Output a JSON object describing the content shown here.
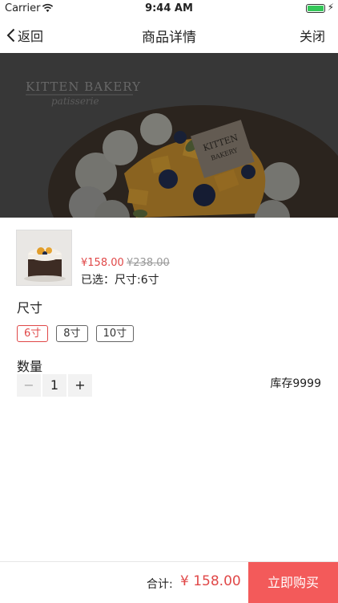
{
  "status": {
    "carrier": "Carrier",
    "time": "9:44 AM"
  },
  "nav": {
    "back_label": "返回",
    "title": "商品详情",
    "close_label": "关闭"
  },
  "hero": {
    "brand": "KITTEN BAKERY",
    "tagline": "patisserie",
    "tag_line1": "KITTEN",
    "tag_line2": "BAKERY"
  },
  "product": {
    "price": "¥158.00",
    "original_price": "¥238.00",
    "selected": "已选：尺寸:6寸"
  },
  "size": {
    "label": "尺寸",
    "options": [
      "6寸",
      "8寸",
      "10寸"
    ],
    "selected": "6寸"
  },
  "quantity": {
    "label": "数量",
    "minus": "−",
    "value": "1",
    "plus": "+"
  },
  "stock": "库存9999",
  "footer": {
    "total_label": "合计:",
    "total_value": "¥ 158.00",
    "buy_label": "立即购买"
  },
  "colors": {
    "accent": "#e04848",
    "buy_button": "#f35a5a",
    "battery": "#34c759"
  }
}
